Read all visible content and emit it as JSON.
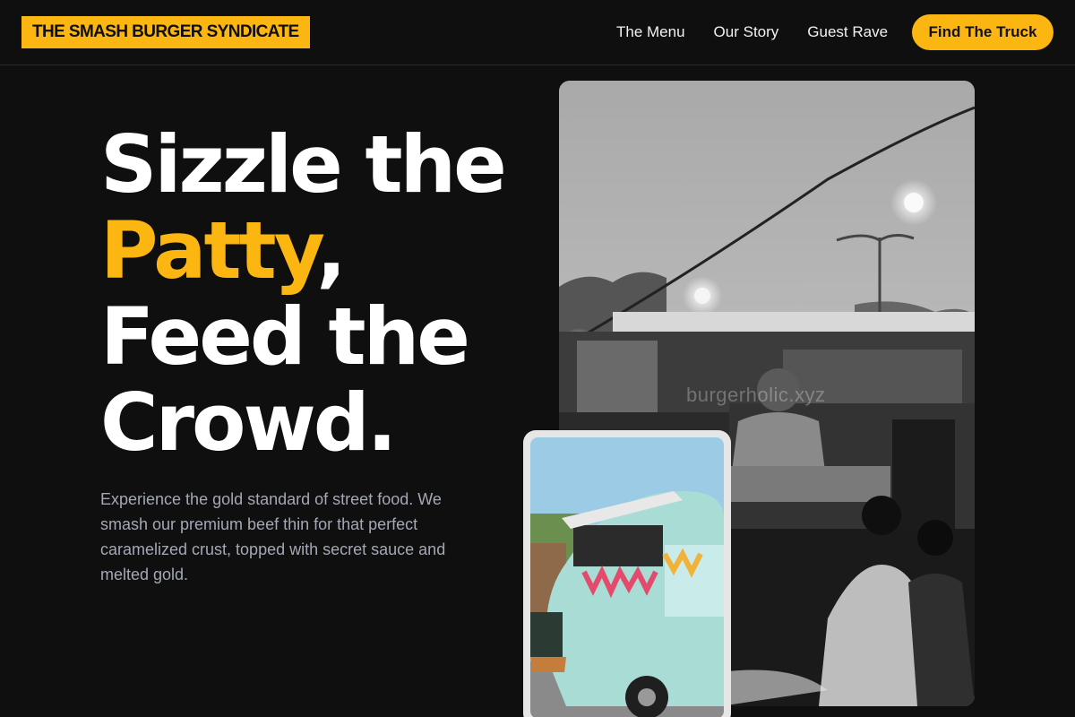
{
  "header": {
    "logo": "THE SMASH BURGER SYNDICATE",
    "nav": [
      "The Menu",
      "Our Story",
      "Guest Rave"
    ],
    "cta": "Find The Truck"
  },
  "hero": {
    "line1": "Sizzle the",
    "line2_highlight": "Patty",
    "line2_rest": ",",
    "line3": "Feed the",
    "line4": "Crowd.",
    "description": "Experience the gold standard of street food. We smash our premium beef thin for that perfect caramelized crust, topped with secret sauce and melted gold."
  },
  "images": {
    "main_watermark": "burgerholic.xyz"
  },
  "colors": {
    "accent": "#fbb612",
    "background": "#0f0f0f",
    "body_text": "#a3a8b4"
  }
}
